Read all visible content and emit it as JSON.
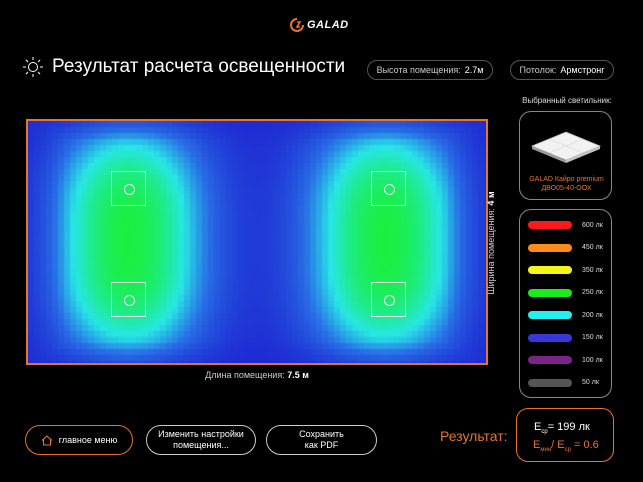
{
  "brand": {
    "logo_text": "GALAD"
  },
  "header": {
    "title": "Результат расчета освещенности",
    "room_height_label": "Высота помещения:",
    "room_height_value": "2.7м",
    "ceiling_label": "Потолок:",
    "ceiling_value": "Армстронг"
  },
  "room": {
    "length_label": "Длина помещения:",
    "length_value": "7.5 м",
    "width_label": "Ширина помещения:",
    "width_value": "4 м"
  },
  "luminaire": {
    "section_label": "Выбранный светильник:",
    "name_line1": "GALAD Кайро premium",
    "name_line2": "ДВО05-40-ООХ"
  },
  "legend": [
    {
      "label": "600 лк",
      "color": "#ff1a1a"
    },
    {
      "label": "450 лк",
      "color": "#ff8a1c"
    },
    {
      "label": "350 лк",
      "color": "#f5f51a"
    },
    {
      "label": "250 лк",
      "color": "#1aee1a"
    },
    {
      "label": "200 лк",
      "color": "#25f0f0"
    },
    {
      "label": "150 лк",
      "color": "#3838d8"
    },
    {
      "label": "100 лк",
      "color": "#7a2488"
    },
    {
      "label": "50 лк",
      "color": "#555555"
    }
  ],
  "buttons": {
    "home": "главное меню",
    "change_settings_line1": "Изменить настройки",
    "change_settings_line2": "помещения...",
    "save_line1": "Сохранить",
    "save_line2": "как PDF"
  },
  "result": {
    "label": "Результат:",
    "e_symbol": "E",
    "e_sub": "ср",
    "e_value": "= 199 лк",
    "ratio_min_sub": "мин",
    "ratio_den_sub": "ср",
    "ratio_value": "= 0.6"
  },
  "colors": {
    "accent": "#e8732a",
    "background": "#000000"
  }
}
